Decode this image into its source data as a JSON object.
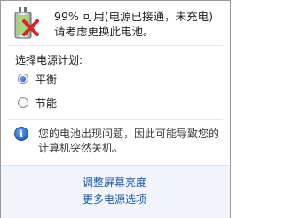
{
  "status": {
    "line1": "99% 可用(电源已接通，未充电)",
    "line2": "请考虑更换此电池。"
  },
  "plan": {
    "title": "选择电源计划:",
    "options": [
      {
        "label": "平衡",
        "selected": true
      },
      {
        "label": "节能",
        "selected": false
      }
    ]
  },
  "warning": {
    "line1": "您的电池出现问题，因此可能导致您的",
    "line2": "计算机突然关机。"
  },
  "links": {
    "brightness": "调整屏幕亮度",
    "more_options": "更多电源选项"
  },
  "icons": {
    "battery": "battery-warning-icon",
    "info": "info-icon"
  },
  "colors": {
    "link": "#1e5aa8",
    "footer_bg": "#f1f5fb",
    "error_x": "#d4262a"
  }
}
